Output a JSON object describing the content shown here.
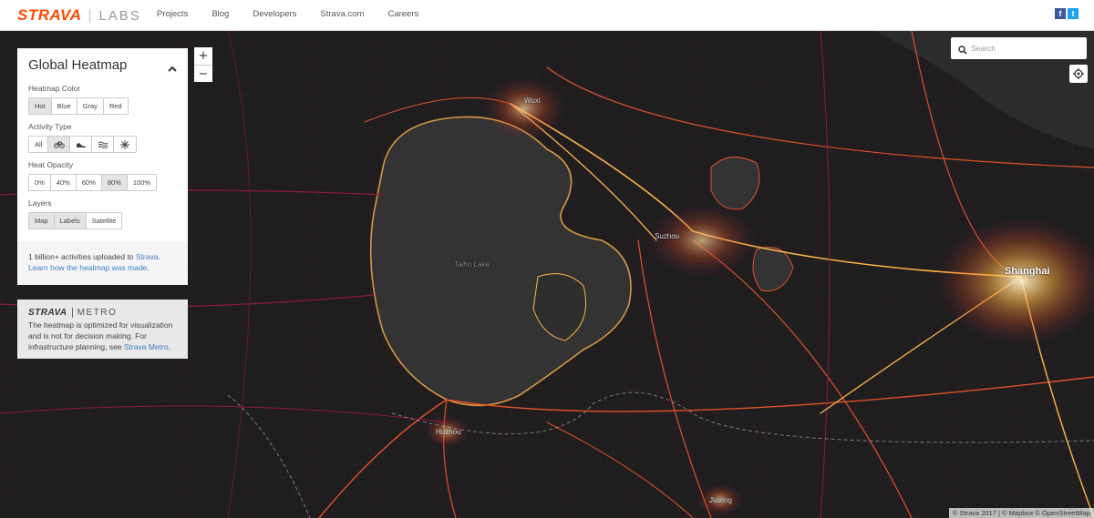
{
  "nav": {
    "brand_strava": "STRAVA",
    "brand_labs": "LABS",
    "links": [
      "Projects",
      "Blog",
      "Developers",
      "Strava.com",
      "Careers"
    ],
    "facebook": "f",
    "twitter": "t"
  },
  "panel": {
    "title": "Global Heatmap",
    "heatmap_color": {
      "label": "Heatmap Color",
      "options": [
        "Hot",
        "Blue",
        "Gray",
        "Red"
      ],
      "selected": "Hot"
    },
    "activity_type": {
      "label": "Activity Type",
      "all_label": "All",
      "icons": [
        "bike-icon",
        "run-icon",
        "water-icon",
        "winter-icon"
      ],
      "selected": "bike-icon"
    },
    "heat_opacity": {
      "label": "Heat Opacity",
      "options": [
        "0%",
        "40%",
        "60%",
        "80%",
        "100%"
      ],
      "selected": "80%"
    },
    "layers": {
      "label": "Layers",
      "options": [
        "Map",
        "Labels",
        "Satellite"
      ],
      "selected": [
        "Map",
        "Labels"
      ]
    },
    "footer": {
      "text1": "1 billion+ activities uploaded to ",
      "link1": "Strava",
      "text1_end": ".",
      "link2": "Learn how the heatmap was made",
      "text2_end": "."
    }
  },
  "metro": {
    "brand_strava": "STRAVA",
    "brand_word": "METRO",
    "text": "The heatmap is optimized for visualization and is not for decision making. For infrastructure planning, see ",
    "link": "Strava Metro",
    "text_end": "."
  },
  "zoom": {
    "in": "+",
    "out": "−"
  },
  "search": {
    "placeholder": "Search"
  },
  "map": {
    "labels": {
      "wuxi": "Wuxi",
      "suzhou": "Suzhou",
      "taihu": "Taihu Lake",
      "shanghai": "Shanghai",
      "huzhou": "Huzhou",
      "jiaxing": "Jiaxing"
    },
    "attribution": "© Strava 2017 | © Mapbox © OpenStreetMap"
  },
  "colors": {
    "brand": "#fc4c02",
    "heat_hot": "#ffb347",
    "heat_mid": "#e0502a",
    "heat_low": "#8b1a4a",
    "link": "#3e7ec4"
  }
}
